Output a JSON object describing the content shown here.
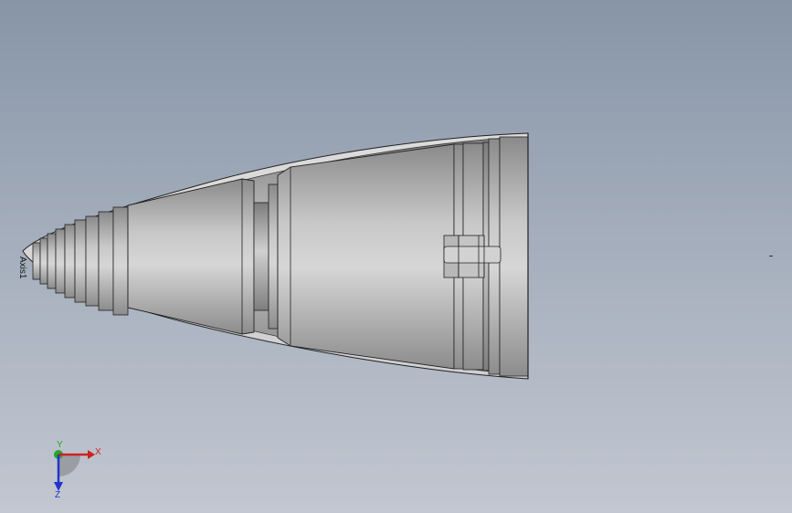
{
  "viewport": {
    "background_top": "#8795a7",
    "background_bottom": "#c2c7d1"
  },
  "model": {
    "axis_tag": "Axis1",
    "shell_color": "#d4d4d4",
    "edge_color": "#222222"
  },
  "triad": {
    "x_label": "X",
    "y_label": "Y",
    "z_label": "Z",
    "x_color": "#cc2222",
    "y_color": "#22aa22",
    "z_color": "#2233cc"
  }
}
